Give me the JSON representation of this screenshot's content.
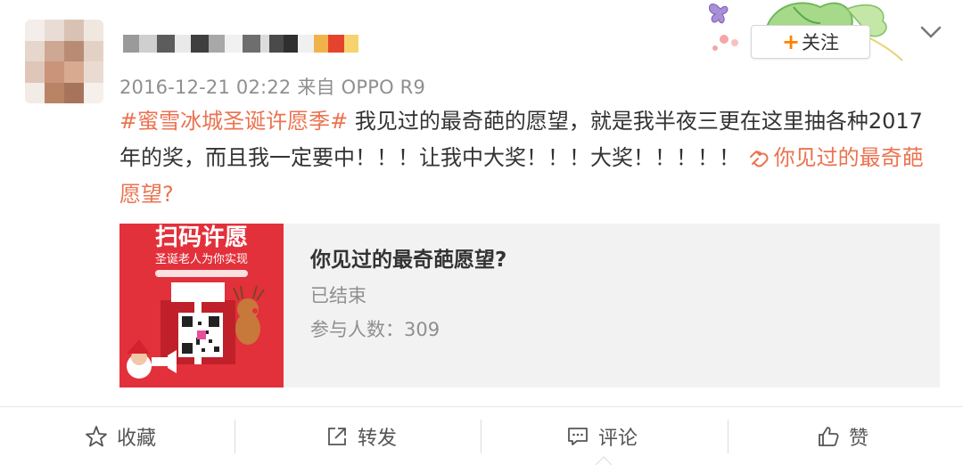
{
  "header": {
    "timestamp": "2016-12-21 02:22",
    "source_prefix": "来自",
    "source_device": "OPPO R9",
    "follow_label": "关注",
    "follow_plus": "+"
  },
  "post": {
    "hashtag": "#蜜雪冰城圣诞许愿季#",
    "text": " 我见过的最奇葩的愿望，就是我半夜三更在这里抽各种2017年的奖，而且我一定要中！！！让我中大奖！！！大奖！！！！！ ",
    "link_text": "你见过的最奇葩愿望?"
  },
  "card": {
    "image_caption": "扫码许愿",
    "image_subcaption": "圣诞老人为你实现",
    "title": "你见过的最奇葩愿望?",
    "status": "已结束",
    "count_label": "参与人数：",
    "count_value": "309"
  },
  "actions": [
    {
      "label": "收藏",
      "icon": "star-icon"
    },
    {
      "label": "转发",
      "icon": "forward-icon"
    },
    {
      "label": "评论",
      "icon": "comment-icon"
    },
    {
      "label": "赞",
      "icon": "thumbs-up-icon"
    }
  ],
  "colors": {
    "accent": "#eb7350",
    "follow_plus": "#ff8200",
    "card_bg": "#f2f2f2",
    "card_image_bg": "#e2313b"
  }
}
